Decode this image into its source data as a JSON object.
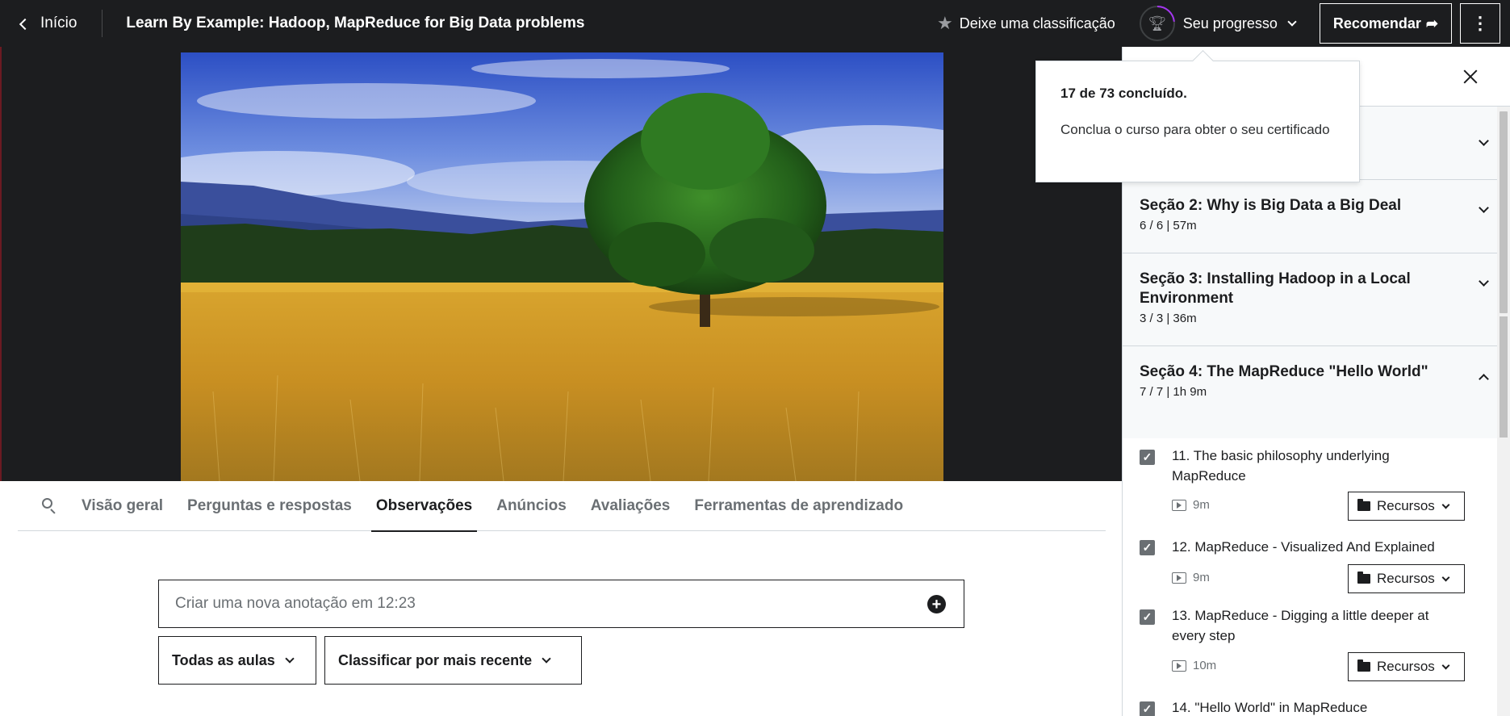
{
  "header": {
    "back_label": "Início",
    "course_title": "Learn By Example: Hadoop, MapReduce for Big Data problems",
    "rate_label": "Deixe uma classificação",
    "progress_label": "Seu progresso",
    "recommend_label": "Recomendar",
    "progress_completed": 17,
    "progress_total": 73
  },
  "popover": {
    "title": "17 de 73 concluído.",
    "body": "Conclua o curso para obter o seu certificado"
  },
  "tabs": [
    {
      "label": "Visão geral"
    },
    {
      "label": "Perguntas e respostas"
    },
    {
      "label": "Observações"
    },
    {
      "label": "Anúncios"
    },
    {
      "label": "Avaliações"
    },
    {
      "label": "Ferramentas de aprendizado"
    }
  ],
  "notes": {
    "placeholder": "Criar uma nova anotação em 12:23",
    "filter_all": "Todas as aulas",
    "sort": "Classificar por mais recente"
  },
  "sidebar": {
    "sections": [
      {
        "title": "Seção 2: Why is Big Data a Big Deal",
        "meta": "6 / 6 | 57m"
      },
      {
        "title": "Seção 3: Installing Hadoop in a Local Environment",
        "meta": "3 / 3 | 36m"
      },
      {
        "title": "Seção 4: The MapReduce \"Hello World\"",
        "meta": "7 / 7 | 1h 9m"
      }
    ],
    "lessons": [
      {
        "title": "11. The basic philosophy underlying MapReduce",
        "duration": "9m",
        "resources": "Recursos"
      },
      {
        "title": "12. MapReduce - Visualized And Explained",
        "duration": "9m",
        "resources": "Recursos"
      },
      {
        "title": "13. MapReduce - Digging a little deeper at every step",
        "duration": "10m",
        "resources": "Recursos"
      },
      {
        "title": "14. \"Hello World\" in MapReduce"
      }
    ]
  }
}
